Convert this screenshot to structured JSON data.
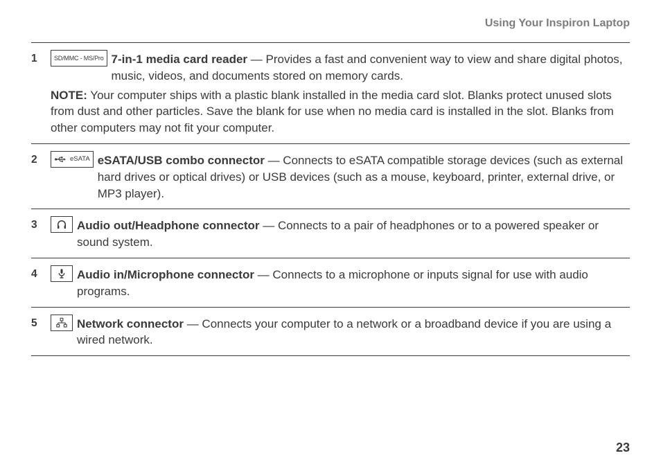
{
  "header": "Using Your Inspiron Laptop",
  "page_number": "23",
  "items": [
    {
      "num": "1",
      "icon_text": "SD/MMC - MS/Pro",
      "title": "7-in-1 media card reader",
      "desc": " — Provides a fast and convenient way to view and share digital photos, music, videos, and documents stored on memory cards.",
      "note_label": "NOTE:",
      "note_body": " Your computer ships with a plastic blank installed in the media card slot. Blanks protect unused slots from dust and other particles. Save the blank for use when no media card is installed in the slot. Blanks from other computers may not fit your computer."
    },
    {
      "num": "2",
      "icon_text": "eSATA",
      "title": "eSATA/USB combo connector",
      "desc": " — Connects to eSATA compatible storage devices (such as external hard drives or optical drives) or USB devices (such as a mouse, keyboard, printer, external drive, or MP3 player)."
    },
    {
      "num": "3",
      "title": "Audio out/Headphone connector",
      "desc": " — Connects to a pair of headphones or to a powered speaker or sound system."
    },
    {
      "num": "4",
      "title": "Audio in/Microphone connector",
      "desc": " — Connects to a microphone or inputs signal for use with audio programs."
    },
    {
      "num": "5",
      "title": "Network connector",
      "desc": " — Connects your computer to a network or a broadband device if you are using a wired network."
    }
  ]
}
